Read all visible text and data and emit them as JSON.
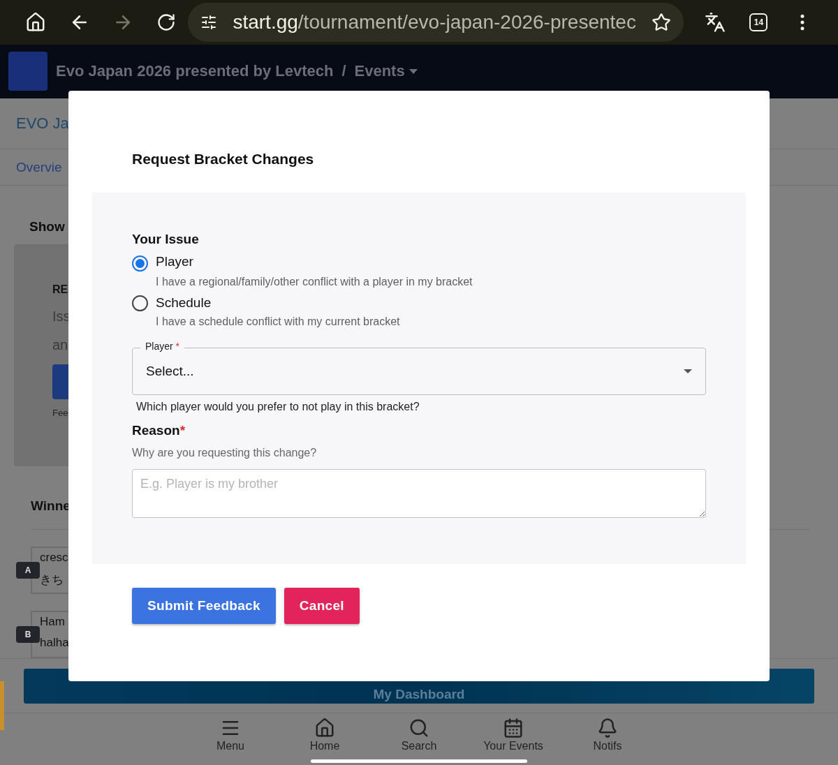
{
  "browser": {
    "url_host": "start.gg",
    "url_path": "/tournament/evo-japan-2026-presentec",
    "tab_count": "14"
  },
  "site_header": {
    "title": "Evo Japan 2026 presented by Levtech",
    "separator": "/",
    "section": "Events"
  },
  "background": {
    "page_title": "EVO Ja",
    "tab": "Overvie",
    "show_label": "Show",
    "card": {
      "heading": "RE",
      "lines": [
        "Iss",
        "an"
      ],
      "footer": "Fee"
    },
    "winners_label": "Winne",
    "matches": [
      {
        "badge": "A",
        "players": [
          "cresc",
          "きち"
        ]
      },
      {
        "badge": "B",
        "players": [
          "Ham",
          "halha"
        ]
      }
    ],
    "dashboard_button": "My Dashboard"
  },
  "modal": {
    "title": "Request Bracket Changes",
    "issue_label": "Your Issue",
    "options": [
      {
        "label": "Player",
        "description": "I have a regional/family/other conflict with a player in my bracket",
        "selected": true
      },
      {
        "label": "Schedule",
        "description": "I have a schedule conflict with my current bracket",
        "selected": false
      }
    ],
    "player_field": {
      "label": "Player",
      "required_mark": "*",
      "value": "Select...",
      "helper": "Which player would you prefer to not play in this bracket?"
    },
    "reason": {
      "label": "Reason",
      "required_mark": "*",
      "hint": "Why are you requesting this change?",
      "placeholder": "E.g. Player is my brother"
    },
    "buttons": [
      {
        "label": "Submit Feedback",
        "kind": "primary"
      },
      {
        "label": "Cancel",
        "kind": "danger"
      }
    ]
  },
  "bottom_nav": [
    {
      "label": "Menu",
      "kind": "menu"
    },
    {
      "label": "Home",
      "kind": "home"
    },
    {
      "label": "Search",
      "kind": "search"
    },
    {
      "label": "Your Events",
      "kind": "events"
    },
    {
      "label": "Notifs",
      "kind": "bell"
    }
  ]
}
